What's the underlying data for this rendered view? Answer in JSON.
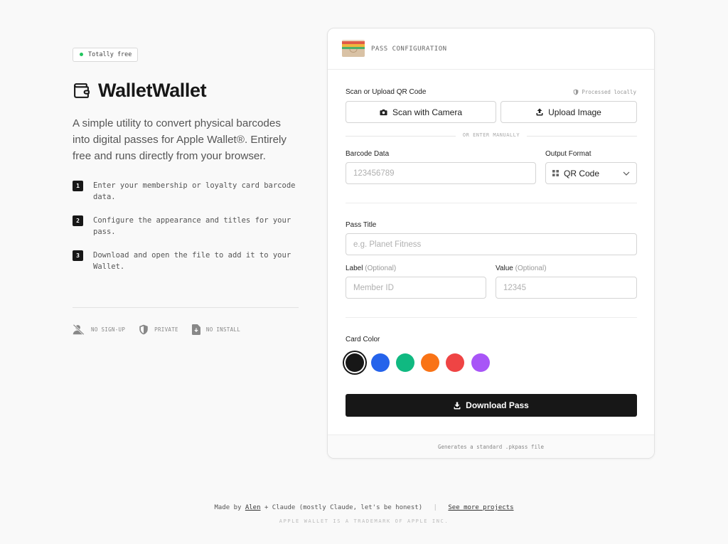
{
  "hero": {
    "badge": "Totally free",
    "title": "WalletWallet",
    "description": "A simple utility to convert physical barcodes into digital passes for Apple Wallet®. Entirely free and runs directly from your browser.",
    "steps": [
      {
        "num": "1",
        "text": "Enter your membership or loyalty card barcode data."
      },
      {
        "num": "2",
        "text": "Configure the appearance and titles for your pass."
      },
      {
        "num": "3",
        "text": "Download and open the file to add it to your Wallet."
      }
    ],
    "features": [
      {
        "label": "NO SIGN-UP",
        "icon": "user-off-icon"
      },
      {
        "label": "PRIVATE",
        "icon": "shield-icon"
      },
      {
        "label": "NO INSTALL",
        "icon": "file-download-icon"
      }
    ]
  },
  "card": {
    "header_title": "PASS CONFIGURATION",
    "scan_label": "Scan or Upload QR Code",
    "processed_note": "Processed locally",
    "scan_button": "Scan with Camera",
    "upload_button": "Upload Image",
    "or_text": "OR ENTER MANUALLY",
    "barcode_label": "Barcode Data",
    "barcode_placeholder": "123456789",
    "format_label": "Output Format",
    "format_value": "QR Code",
    "pass_title_label": "Pass Title",
    "pass_title_placeholder": "e.g. Planet Fitness",
    "label_label": "Label",
    "value_label": "Value",
    "optional": "(Optional)",
    "label_placeholder": "Member ID",
    "value_placeholder": "12345",
    "color_label": "Card Color",
    "colors": [
      "#171717",
      "#2563eb",
      "#10b981",
      "#f97316",
      "#ef4444",
      "#a855f7"
    ],
    "selected_color": "#171717",
    "download_button": "Download Pass",
    "footer_note": "Generates a standard .pkpass file"
  },
  "footer": {
    "made_by_prefix": "Made by",
    "author": "Alen",
    "made_by_suffix": "+ Claude (mostly Claude, let's be honest)",
    "more_link": "See more projects",
    "trademark": "APPLE WALLET IS A TRADEMARK OF APPLE INC."
  }
}
